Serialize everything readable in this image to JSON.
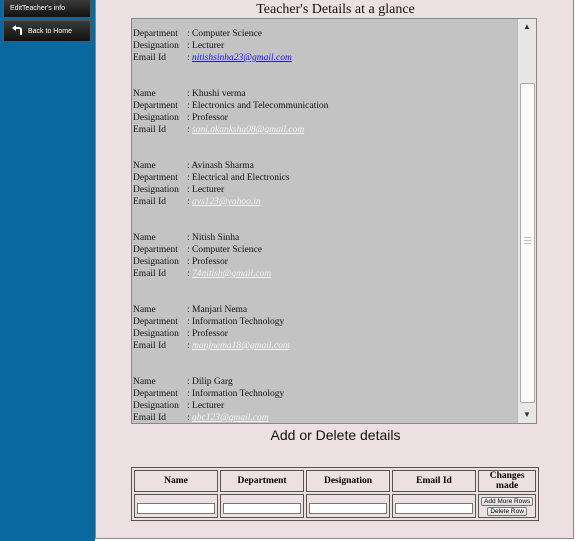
{
  "sidebar": {
    "edit_label": "EditTeacher's info",
    "home_label": "Back to Home"
  },
  "page_title": "Teacher's Details at a glance",
  "field_labels": {
    "name": "Name",
    "department": "Department",
    "designation": "Designation",
    "email": "Email Id"
  },
  "teachers": [
    {
      "name": "",
      "department": "Computer Science",
      "designation": "Lecturer",
      "email": "nitishsinha23@gmail.com"
    },
    {
      "name": "Khushi verma",
      "department": "Electronics and Telecommunication",
      "designation": "Professor",
      "email": "soni.akanksha08@gmail.com"
    },
    {
      "name": "Avinash Sharma",
      "department": "Electrical and Electronics",
      "designation": "Lecturer",
      "email": "avs123@yahoo.in"
    },
    {
      "name": "Nitish Sinha",
      "department": "Computer Science",
      "designation": "Professor",
      "email": "74nitish@gmail.com"
    },
    {
      "name": "Manjari Nema",
      "department": "Information Technology",
      "designation": "Professor",
      "email": "manjnema18@gmail.com"
    },
    {
      "name": "Dilip Garg",
      "department": "Information Technology",
      "designation": "Lecturer",
      "email": "abc123@gmail.com"
    }
  ],
  "section_title": "Add or Delete details",
  "edit_table": {
    "headers": [
      "Name",
      "Department",
      "Designation",
      "Email Id",
      "Changes made"
    ],
    "add_label": "Add More Rows",
    "delete_label": "Delete Row"
  },
  "icons": {
    "home": "back-arrow-icon",
    "scroll_up": "triangle-up-icon",
    "scroll_down": "triangle-down-icon"
  },
  "colors": {
    "sidebar": "#0a68a0",
    "panel": "#ede0e3",
    "list_bg": "#c3c3c3",
    "link_first": "#1a1adb"
  }
}
